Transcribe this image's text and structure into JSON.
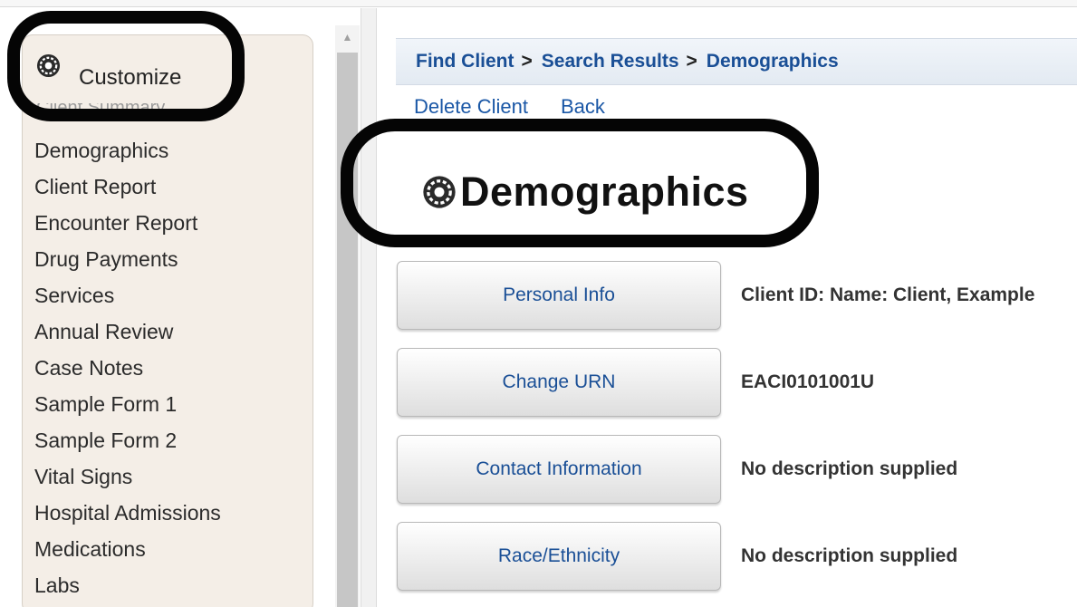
{
  "sidebar": {
    "customize_label": "Customize",
    "hidden_item_label": "Client Summary",
    "items": [
      {
        "label": "Demographics"
      },
      {
        "label": "Client Report"
      },
      {
        "label": "Encounter Report"
      },
      {
        "label": "Drug Payments"
      },
      {
        "label": "Services"
      },
      {
        "label": "Annual Review"
      },
      {
        "label": "Case Notes"
      },
      {
        "label": "Sample Form 1"
      },
      {
        "label": "Sample Form 2"
      },
      {
        "label": "Vital Signs"
      },
      {
        "label": "Hospital Admissions"
      },
      {
        "label": "Medications"
      },
      {
        "label": "Labs"
      }
    ]
  },
  "breadcrumb": {
    "items": [
      "Find Client",
      "Search Results",
      "Demographics"
    ],
    "separator": ">"
  },
  "actions": {
    "delete_label": "Delete Client",
    "back_label": "Back"
  },
  "page": {
    "title": "Demographics"
  },
  "sections": [
    {
      "button_label": "Personal Info",
      "description": "Client ID: Name: Client, Example"
    },
    {
      "button_label": "Change URN",
      "description": "EACI0101001U"
    },
    {
      "button_label": "Contact Information",
      "description": "No description supplied"
    },
    {
      "button_label": "Race/Ethnicity",
      "description": "No description supplied"
    }
  ],
  "colors": {
    "link": "#1a4f96",
    "sidebar_bg": "#f4eee7",
    "annotation": "#050505"
  },
  "icons": {
    "customize": "gear-icon",
    "title": "gear-icon"
  }
}
